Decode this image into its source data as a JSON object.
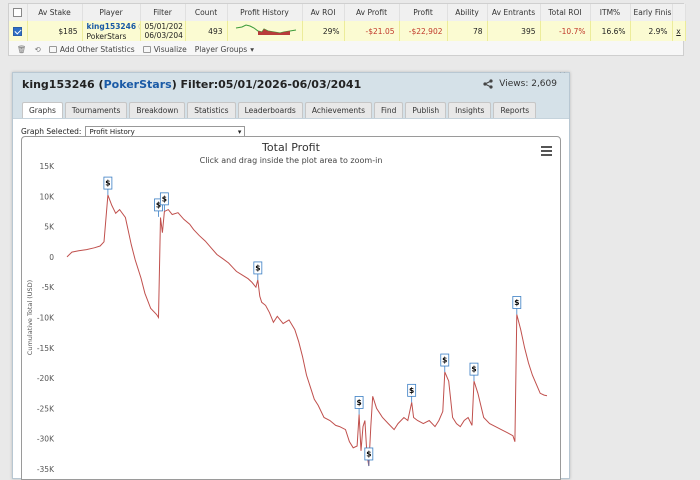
{
  "stats_table": {
    "headers": [
      "",
      "Av Stake",
      "Player",
      "Filter",
      "Count",
      "Profit History",
      "Av ROI",
      "Av Profit",
      "Profit",
      "Ability",
      "Av Entrants",
      "Total ROI",
      "ITM%",
      "Early Finish",
      ""
    ],
    "row": {
      "av_stake": "$185",
      "player_name": "king153246",
      "player_site": "PokerStars",
      "filter_from": "05/01/202",
      "filter_to": "06/03/204",
      "count": "493",
      "av_roi": "29%",
      "av_profit": "-$21.05",
      "profit": "-$22,902",
      "ability": "78",
      "av_entrants": "395",
      "total_roi": "-10.7%",
      "itm": "16.6%",
      "early_finish": "2.9%",
      "remove": "x"
    },
    "toolbar": {
      "add_stats": "Add Other Statistics",
      "visualize": "Visualize",
      "player_groups": "Player Groups"
    }
  },
  "panel": {
    "player": "king153246",
    "site": "PokerStars",
    "filter": "Filter:05/01/2026-06/03/2041",
    "views": "Views: 2,609",
    "close": "×",
    "tabs": [
      "Graphs",
      "Tournaments",
      "Breakdown",
      "Statistics",
      "Leaderboards",
      "Achievements",
      "Find",
      "Publish",
      "Insights",
      "Reports"
    ],
    "graph_selected_label": "Graph Selected:",
    "graph_selected_value": "Profit History"
  },
  "colors": {
    "line": "#c0504d",
    "marker_border": "#3b7fc4",
    "panel_header": "#d5e1e8",
    "row_highlight": "#fbfbd2"
  },
  "chart_data": {
    "type": "line",
    "title": "Total Profit",
    "subtitle": "Click and drag inside the plot area to zoom-in",
    "ylabel": "Cumulative Total (USD)",
    "ylim": [
      -35000,
      15000
    ],
    "yticks": [
      15000,
      10000,
      5000,
      0,
      -5000,
      -10000,
      -15000,
      -20000,
      -25000,
      -30000,
      -35000
    ],
    "ytick_labels": [
      "15K",
      "10K",
      "5K",
      "0",
      "-5K",
      "-10K",
      "-15K",
      "-20K",
      "-25K",
      "-30K",
      "-35K"
    ],
    "grid": false,
    "x_tournaments": 493,
    "points": [
      [
        0,
        0
      ],
      [
        5,
        800
      ],
      [
        12,
        1000
      ],
      [
        20,
        1200
      ],
      [
        28,
        1500
      ],
      [
        34,
        1800
      ],
      [
        38,
        2500
      ],
      [
        42,
        10200
      ],
      [
        46,
        8500
      ],
      [
        50,
        7200
      ],
      [
        54,
        7800
      ],
      [
        60,
        6500
      ],
      [
        66,
        2000
      ],
      [
        70,
        -500
      ],
      [
        76,
        -3500
      ],
      [
        80,
        -6000
      ],
      [
        86,
        -8500
      ],
      [
        92,
        -9500
      ],
      [
        94,
        -10000
      ],
      [
        96,
        6500
      ],
      [
        98,
        4000
      ],
      [
        100,
        7500
      ],
      [
        104,
        7800
      ],
      [
        108,
        7000
      ],
      [
        114,
        7300
      ],
      [
        120,
        6200
      ],
      [
        126,
        5400
      ],
      [
        130,
        4500
      ],
      [
        136,
        3500
      ],
      [
        142,
        2600
      ],
      [
        148,
        1500
      ],
      [
        154,
        400
      ],
      [
        160,
        -300
      ],
      [
        166,
        -1000
      ],
      [
        170,
        -1700
      ],
      [
        174,
        -2400
      ],
      [
        180,
        -3000
      ],
      [
        186,
        -3600
      ],
      [
        190,
        -4200
      ],
      [
        194,
        -5000
      ],
      [
        196,
        -3800
      ],
      [
        198,
        -6500
      ],
      [
        200,
        -7500
      ],
      [
        204,
        -8000
      ],
      [
        208,
        -9200
      ],
      [
        212,
        -10800
      ],
      [
        216,
        -9800
      ],
      [
        222,
        -11000
      ],
      [
        228,
        -10400
      ],
      [
        234,
        -12000
      ],
      [
        238,
        -14000
      ],
      [
        242,
        -16500
      ],
      [
        246,
        -19500
      ],
      [
        250,
        -21500
      ],
      [
        254,
        -23500
      ],
      [
        258,
        -24500
      ],
      [
        264,
        -26500
      ],
      [
        270,
        -27000
      ],
      [
        276,
        -27800
      ],
      [
        280,
        -28000
      ],
      [
        286,
        -28500
      ],
      [
        290,
        -30500
      ],
      [
        294,
        -31500
      ],
      [
        298,
        -31200
      ],
      [
        300,
        -26000
      ],
      [
        302,
        -32000
      ],
      [
        304,
        -28000
      ],
      [
        306,
        -27000
      ],
      [
        308,
        -32500
      ],
      [
        310,
        -34500
      ],
      [
        312,
        -28000
      ],
      [
        314,
        -23000
      ],
      [
        318,
        -25000
      ],
      [
        324,
        -26500
      ],
      [
        330,
        -27500
      ],
      [
        336,
        -28500
      ],
      [
        340,
        -27500
      ],
      [
        346,
        -26500
      ],
      [
        350,
        -27000
      ],
      [
        354,
        -24000
      ],
      [
        356,
        -26500
      ],
      [
        360,
        -27000
      ],
      [
        366,
        -27500
      ],
      [
        372,
        -27000
      ],
      [
        378,
        -28000
      ],
      [
        382,
        -27000
      ],
      [
        386,
        -25500
      ],
      [
        388,
        -19000
      ],
      [
        392,
        -20500
      ],
      [
        396,
        -26500
      ],
      [
        400,
        -27500
      ],
      [
        404,
        -28000
      ],
      [
        408,
        -27000
      ],
      [
        412,
        -26500
      ],
      [
        416,
        -27800
      ],
      [
        418,
        -20500
      ],
      [
        422,
        -22500
      ],
      [
        428,
        -26500
      ],
      [
        434,
        -27500
      ],
      [
        440,
        -28000
      ],
      [
        446,
        -28500
      ],
      [
        452,
        -29000
      ],
      [
        458,
        -29500
      ],
      [
        460,
        -30500
      ],
      [
        462,
        -9500
      ],
      [
        466,
        -12000
      ],
      [
        470,
        -15000
      ],
      [
        474,
        -17500
      ],
      [
        478,
        -19500
      ],
      [
        482,
        -21000
      ],
      [
        486,
        -22500
      ],
      [
        490,
        -22800
      ],
      [
        493,
        -22902
      ]
    ],
    "markers": [
      [
        42,
        10200
      ],
      [
        94,
        6600
      ],
      [
        100,
        7600
      ],
      [
        196,
        -3800
      ],
      [
        300,
        -26000
      ],
      [
        310,
        -34500
      ],
      [
        354,
        -24000
      ],
      [
        388,
        -19000
      ],
      [
        418,
        -20500
      ],
      [
        462,
        -9500
      ]
    ],
    "marker_label": "$"
  }
}
